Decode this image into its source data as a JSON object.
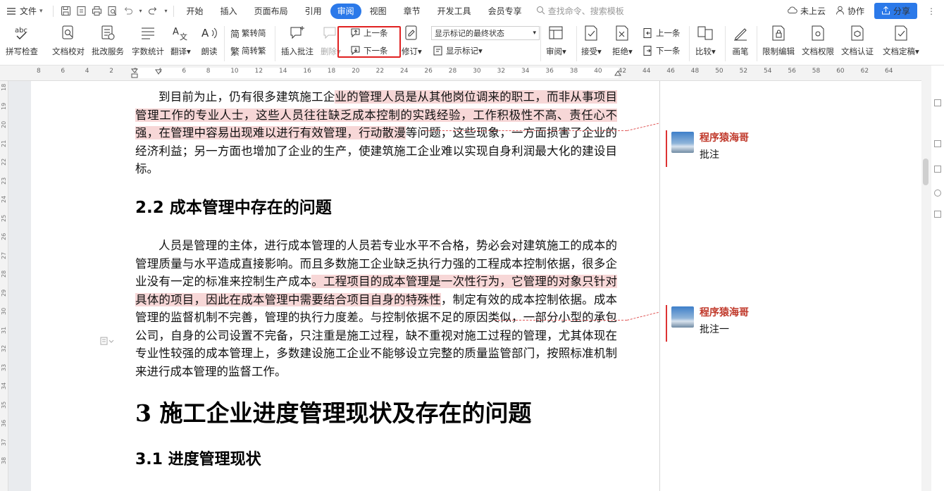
{
  "menubar": {
    "file_label": "文件",
    "menus": [
      "开始",
      "插入",
      "页面布局",
      "引用",
      "审阅",
      "视图",
      "章节",
      "开发工具",
      "会员专享"
    ],
    "active_menu": "审阅",
    "search_placeholder": "查找命令、搜索模板",
    "cloud_label": "未上云",
    "collab_label": "协作",
    "share_label": "分享"
  },
  "ribbon": {
    "spell_check": "拼写检查",
    "doc_proof": "文档校对",
    "revise_service": "批改服务",
    "word_count": "字数统计",
    "translate": "翻译",
    "read_aloud": "朗读",
    "trad_to_simp": "繁转简",
    "simp_to_trad": "简转繁",
    "insert_comment": "插入批注",
    "delete": "删除",
    "prev": "上一条",
    "next": "下一条",
    "revise": "修订",
    "display_state": "显示标记的最终状态",
    "show_markup": "显示标记",
    "review": "审阅",
    "accept": "接受",
    "reject": "拒绝",
    "prev2": "上一条",
    "next2": "下一条",
    "compare": "比较",
    "pen": "画笔",
    "restrict_edit": "限制编辑",
    "doc_permission": "文档权限",
    "doc_certify": "文档认证",
    "doc_finalize": "文档定稿"
  },
  "ruler": {
    "numbers": [
      "8",
      "6",
      "4",
      "2",
      "2",
      "4",
      "6",
      "8",
      "10",
      "12",
      "14",
      "16",
      "18",
      "20",
      "22",
      "24",
      "26",
      "28",
      "30",
      "32",
      "34",
      "36",
      "38",
      "40",
      "42",
      "44",
      "46",
      "48",
      "50",
      "52",
      "54",
      "56",
      "58",
      "60",
      "62",
      "64"
    ],
    "vnumbers": [
      "18",
      "19",
      "20",
      "21",
      "22",
      "23",
      "24",
      "25",
      "26",
      "27",
      "28",
      "29",
      "30",
      "31",
      "32",
      "33",
      "34",
      "35",
      "36",
      "37",
      "38"
    ]
  },
  "document": {
    "p1_a": "到目前为止，仍有很多建筑施工企",
    "p1_hl": "业的管理人员是从其他岗位调来的职工，而非从事项目管理工作的专业人士，这些人员往往缺乏成本控制的实践经验，工作积极性不高、责任心不强，在管理中容易出现难以进行有效管理，行动散漫",
    "p1_b": "等问题，这些现象，一方面损害了企业的经济利益；另一方面也增加了企业的生产，使建筑施工企业难以实现自身利润最大化的建设目标。",
    "h2_1": "2.2 成本管理中存在的问题",
    "p2_a": "人员是管理的主体，进行成本管理的人员若专业水平不合格，势必会对建筑施工的成本的管理质量与水平造成直接影响。而且多数施工企业缺乏执行力强的工程成本控制依据，很多企业没有一定的标准来控制生产成本",
    "p2_hl": "。工程项目的成本管理是一次性行为，它管理的对象只针对具体的项目，因此在成本管理中需要结合项目自身的特殊性",
    "p2_b": "，制定有效的成本控制依据。成本管理的监督机制不完善，管理的执行力度差。与控制依据不足的原因类似，一部分小型的承包公司，自身的公司设置不完备，只注重是施工过程，缺不重视对施工过程的管理，尤其体现在专业性较强的成本管理上，多数建设施工企业不能够设立完整的质量监管部门，按照标准机制来进行成本管理的监督工作。",
    "h1": "3 施工企业进度管理现状及存在的问题",
    "h3": "3.1 进度管理现状"
  },
  "comments": [
    {
      "author": "程序猿海哥",
      "text": "批注"
    },
    {
      "author": "程序猿海哥",
      "text": "批注一"
    }
  ]
}
